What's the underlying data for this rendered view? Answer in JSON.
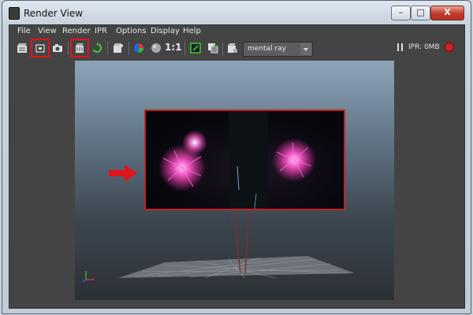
{
  "window": {
    "title": "Render View",
    "controls": {
      "minimize": "–",
      "maximize": "□",
      "close": "X"
    }
  },
  "menu": {
    "items": [
      "File",
      "View",
      "Render",
      "IPR",
      "Options",
      "Display",
      "Help"
    ]
  },
  "toolbar": {
    "ratio_label": "1:1",
    "renderer": "mental ray",
    "ipr_status": "IPR: 0MB",
    "icons": [
      "render-frame-icon",
      "render-region-icon",
      "snapshot-icon",
      "ipr-render-icon",
      "refresh-ipr-icon",
      "render-settings-icon",
      "display-rgb-icon",
      "display-alpha-icon",
      "real-size-icon",
      "keep-image-icon",
      "remove-image-icon",
      "render-settings-window-icon",
      "renderer-dropdown",
      "ipr-pause-icon",
      "ipr-stop-icon"
    ],
    "highlight_color": "#e0151b"
  },
  "viewport": {
    "content": "fireworks-render-preview",
    "accent": "#c22222"
  }
}
